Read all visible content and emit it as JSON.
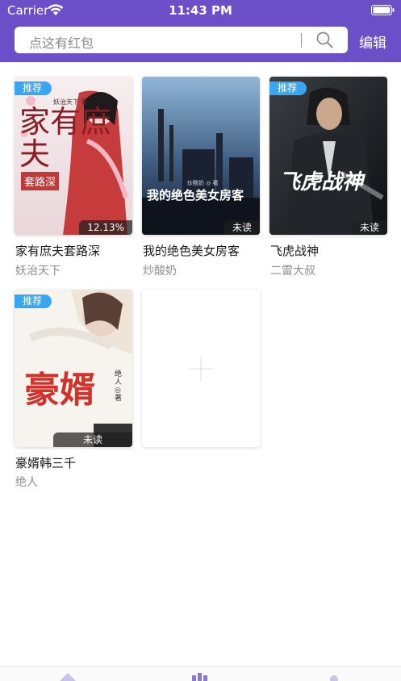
{
  "status": {
    "carrier": "Carrier",
    "time": "11:43 PM"
  },
  "search": {
    "placeholder": "点这有红包"
  },
  "header": {
    "edit_label": "编辑"
  },
  "books": [
    {
      "title": "家有庶夫套路深",
      "author": "妖治天下",
      "badge": "推荐",
      "progress": "12.13%",
      "cover_text": [
        "家有庶夫",
        "套路深",
        "妖治天下 著"
      ]
    },
    {
      "title": "我的绝色美女房客",
      "author": "炒酸奶",
      "badge": "",
      "progress": "未读",
      "cover_text": [
        "炒酸奶 ◎ 著",
        "我的绝色美女房客"
      ]
    },
    {
      "title": "飞虎战神",
      "author": "二雷大叔",
      "badge": "推荐",
      "progress": "未读",
      "cover_text": [
        "飞虎战神"
      ]
    },
    {
      "title": "豪婿韩三千",
      "author": "绝人",
      "badge": "推荐",
      "progress": "未读",
      "cover_text": [
        "豪婿",
        "绝人 ◎ 著"
      ]
    }
  ],
  "colors": {
    "header_bg": "#6b4fc8",
    "badge_bg": "#39a7f0",
    "tab_accent": "#8a78d6"
  },
  "icons": [
    "wifi-icon",
    "battery-icon",
    "search-icon",
    "add-icon",
    "home-tab-icon",
    "library-tab-icon",
    "profile-tab-icon"
  ]
}
